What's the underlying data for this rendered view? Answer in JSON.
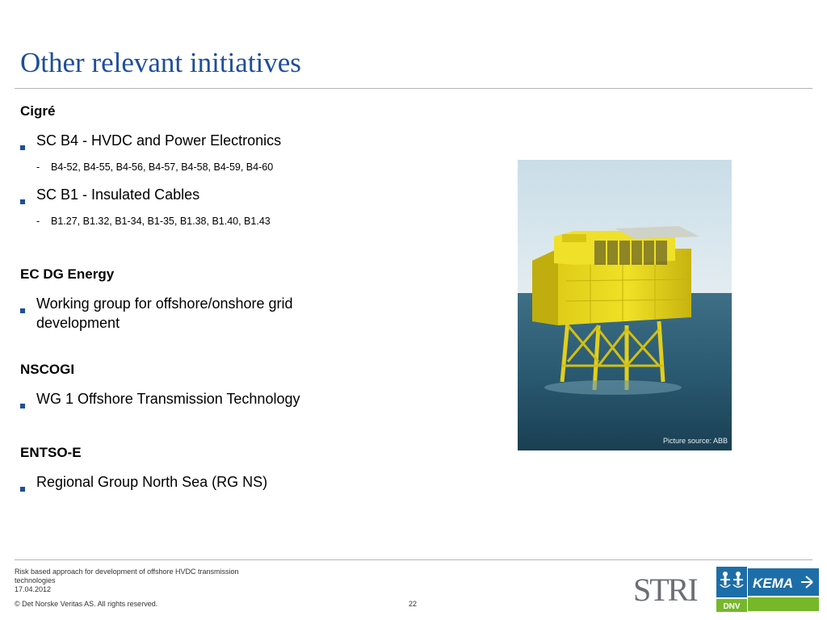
{
  "title": "Other relevant initiatives",
  "sections": [
    {
      "heading": "Cigré",
      "bullets": [
        {
          "text": "SC B4 - HVDC and Power Electronics",
          "sub": "B4-52, B4-55, B4-56, B4-57, B4-58, B4-59, B4-60"
        },
        {
          "text": "SC B1 - Insulated Cables",
          "sub": "B1.27, B1.32, B1-34, B1-35, B1.38, B1.40, B1.43"
        }
      ]
    },
    {
      "heading": "EC DG Energy",
      "bullets": [
        {
          "text": "Working group for offshore/onshore grid development"
        }
      ]
    },
    {
      "heading": "NSCOGI",
      "bullets": [
        {
          "text": "WG 1 Offshore Transmission Technology"
        }
      ]
    },
    {
      "heading": "ENTSO-E",
      "bullets": [
        {
          "text": "Regional Group North Sea (RG NS)"
        }
      ]
    }
  ],
  "image": {
    "caption": "Picture source: ABB"
  },
  "footer": {
    "subject": "Risk based approach for development of offshore HVDC transmission technologies",
    "date": "17.04.2012",
    "copyright": "© Det Norske Veritas AS. All rights reserved.",
    "page_number": "22"
  },
  "logos": {
    "stri": "STRI",
    "dnv": "DNV",
    "kema": "KEMA"
  },
  "colors": {
    "title": "#1f4e9a",
    "bullet": "#1f4e9a",
    "kema_blue": "#1d6ea8",
    "kema_green": "#76b82a"
  }
}
